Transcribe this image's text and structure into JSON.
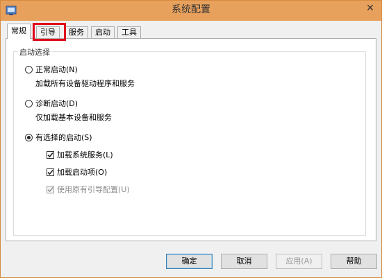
{
  "window": {
    "title": "系统配置",
    "close_label": "✕"
  },
  "tabs": [
    {
      "label": "常规",
      "active": true
    },
    {
      "label": "引导",
      "active": false
    },
    {
      "label": "服务",
      "active": false
    },
    {
      "label": "启动",
      "active": false
    },
    {
      "label": "工具",
      "active": false
    }
  ],
  "group": {
    "label": "启动选择"
  },
  "options": {
    "normal": {
      "label": "正常启动(N)",
      "desc": "加载所有设备驱动程序和服务",
      "checked": false
    },
    "diagnostic": {
      "label": "诊断启动(D)",
      "desc": "仅加载基本设备和服务",
      "checked": false
    },
    "selective": {
      "label": "有选择的启动(S)",
      "checked": true
    }
  },
  "checkboxes": {
    "system_services": {
      "label": "加载系统服务(L)",
      "checked": true
    },
    "startup_items": {
      "label": "加载启动项(O)",
      "checked": true
    },
    "original_boot": {
      "label": "使用原有引导配置(U)",
      "checked": true,
      "disabled": true
    }
  },
  "buttons": {
    "ok": "确定",
    "cancel": "取消",
    "apply": "应用(A)",
    "help": "帮助"
  },
  "colors": {
    "titlebar": "#e8a15d",
    "highlight": "#e0001b"
  }
}
